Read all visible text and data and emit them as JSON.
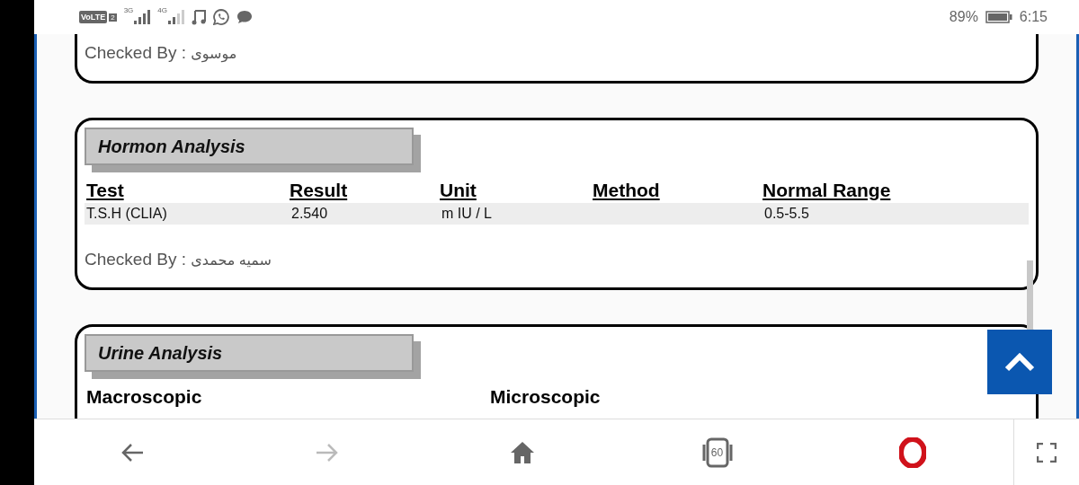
{
  "status_bar": {
    "network": [
      {
        "label": "3G"
      },
      {
        "label": "4G"
      }
    ],
    "volte": "VoLTE",
    "sim": "2",
    "battery_text": "89%",
    "time": "6:15"
  },
  "cards": [
    {
      "partial": true,
      "checked_by_label": "Checked By :",
      "checked_by": "موسوی"
    },
    {
      "partial": false,
      "title": "Hormon Analysis",
      "columns": [
        "Test",
        "Result",
        "Unit",
        "Method",
        "Normal Range"
      ],
      "rows": [
        [
          "T.S.H (CLIA)",
          "2.540",
          "m IU / L",
          "",
          "0.5-5.5"
        ]
      ],
      "checked_by_label": "Checked By :",
      "checked_by": "سمیه محمدی"
    },
    {
      "partial": false,
      "title": "Urine Analysis",
      "subheadings": [
        "Macroscopic",
        "Microscopic"
      ]
    }
  ],
  "nav": [
    {
      "kind": "back",
      "disabled": false
    },
    {
      "kind": "forward",
      "disabled": true
    },
    {
      "kind": "home",
      "disabled": false
    },
    {
      "kind": "tabs",
      "label": "60",
      "disabled": false
    },
    {
      "kind": "opera",
      "disabled": false
    }
  ]
}
